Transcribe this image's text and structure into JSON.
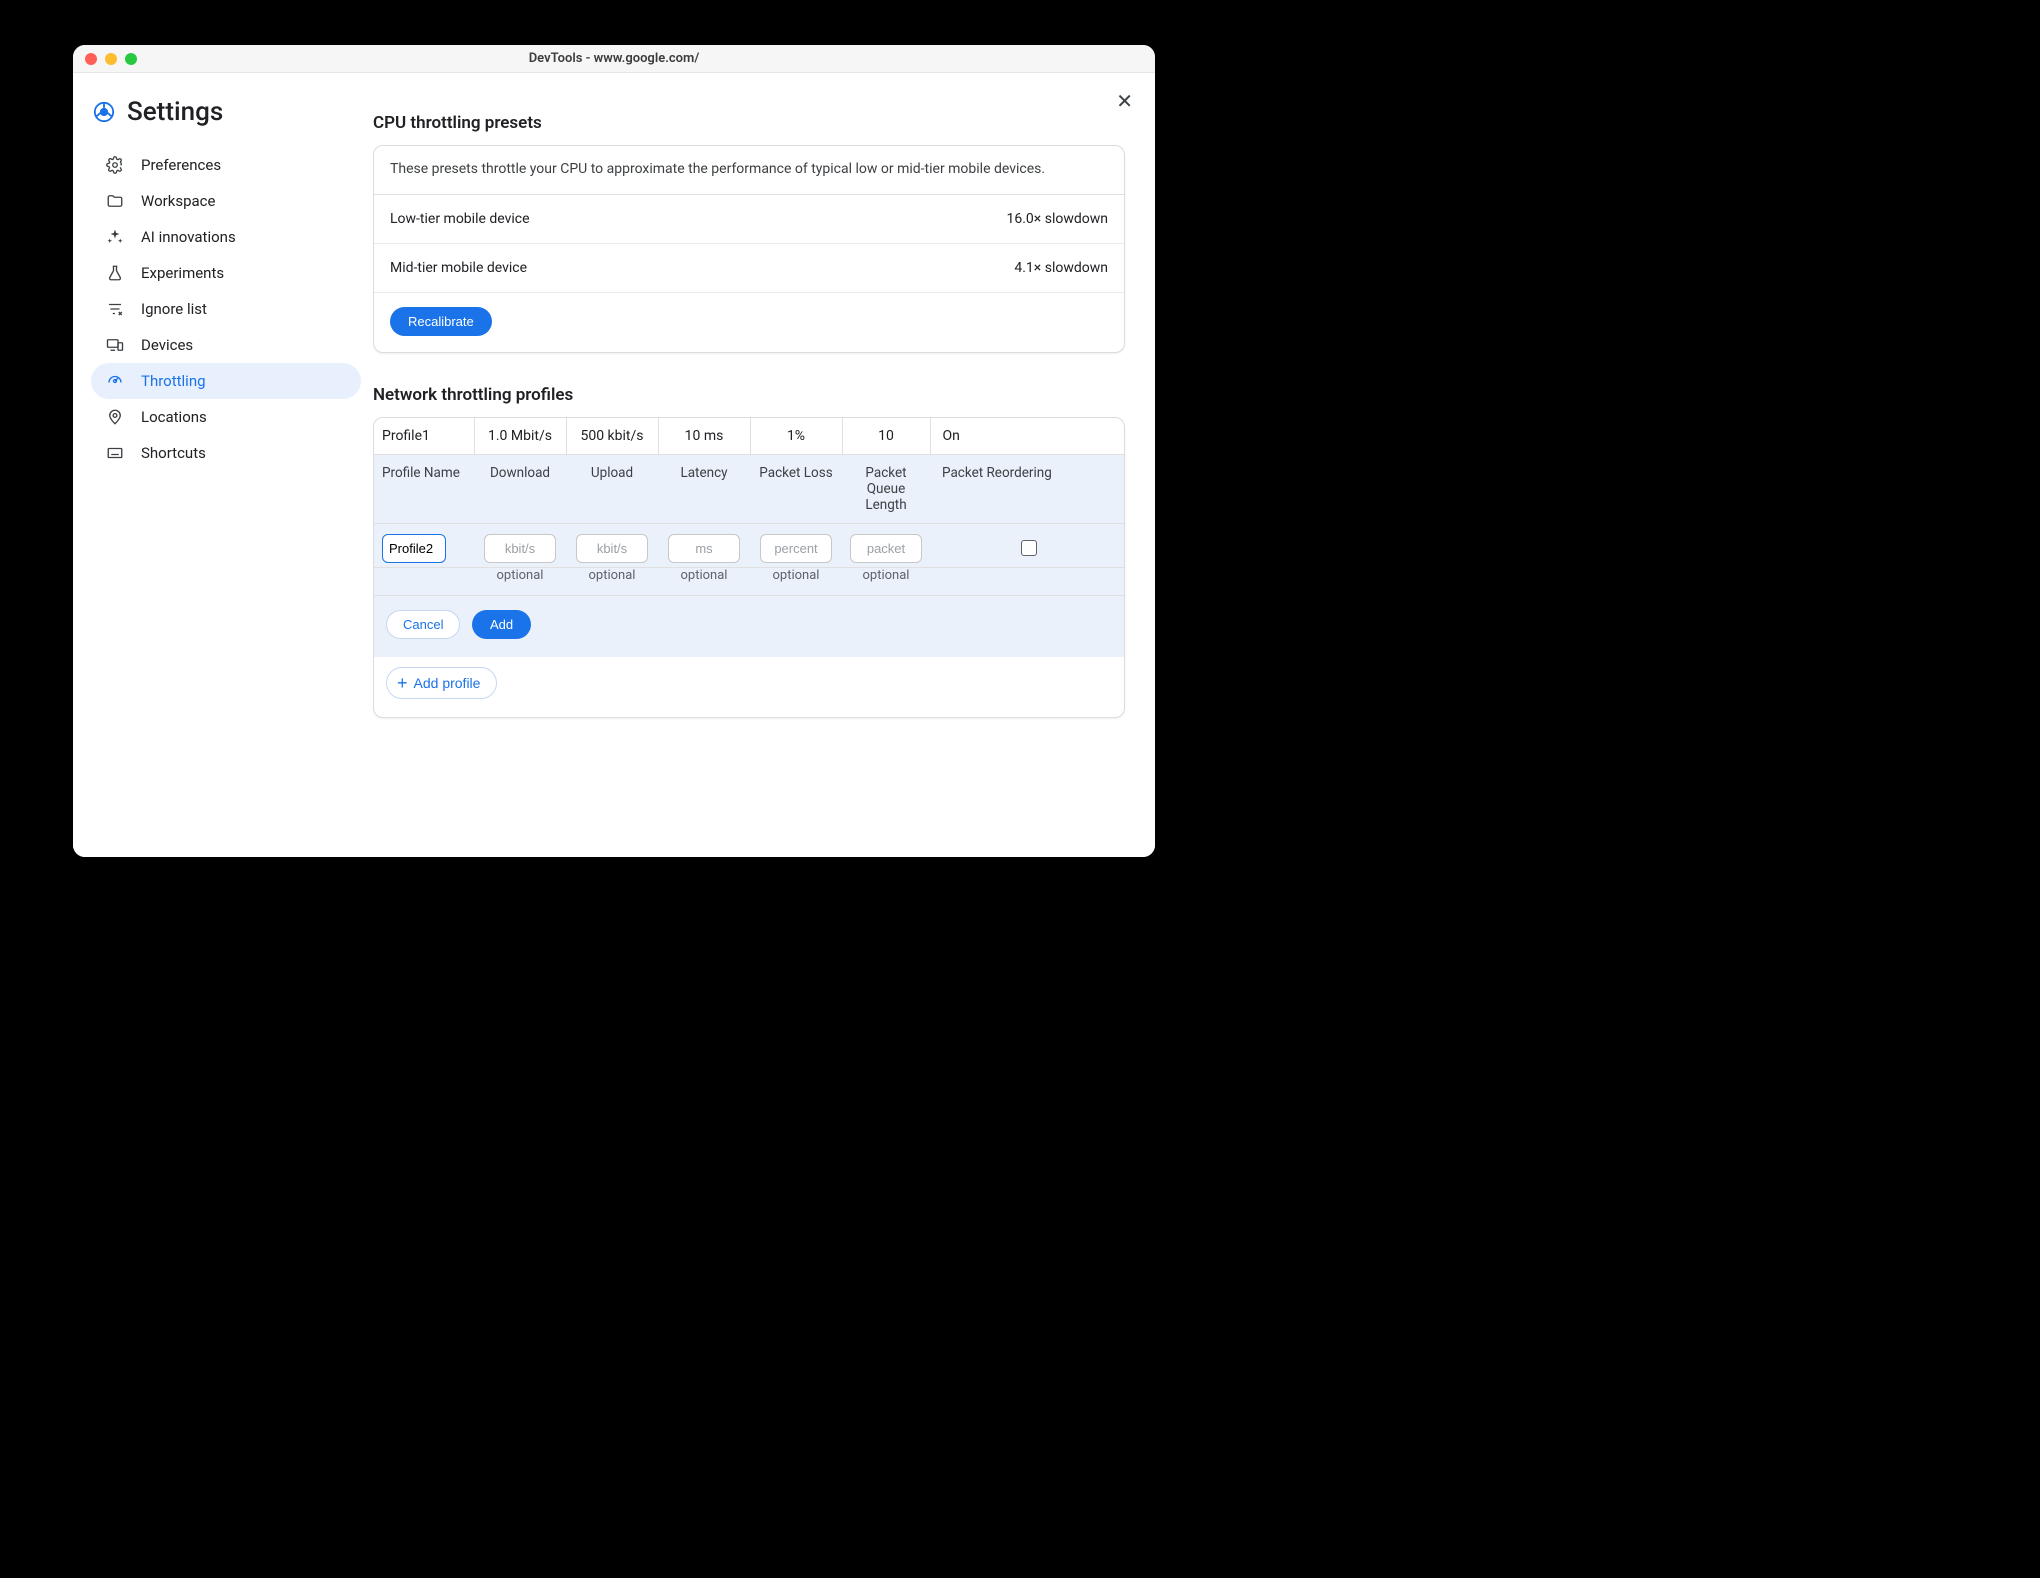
{
  "window_title": "DevTools - www.google.com/",
  "page_title": "Settings",
  "close_label": "✕",
  "sidebar": {
    "items": [
      {
        "label": "Preferences",
        "icon": "gear-icon"
      },
      {
        "label": "Workspace",
        "icon": "folder-icon"
      },
      {
        "label": "AI innovations",
        "icon": "sparkle-icon"
      },
      {
        "label": "Experiments",
        "icon": "flask-icon"
      },
      {
        "label": "Ignore list",
        "icon": "filter-icon"
      },
      {
        "label": "Devices",
        "icon": "devices-icon"
      },
      {
        "label": "Throttling",
        "icon": "speed-icon",
        "active": true
      },
      {
        "label": "Locations",
        "icon": "location-icon"
      },
      {
        "label": "Shortcuts",
        "icon": "keyboard-icon"
      }
    ]
  },
  "cpu_section": {
    "title": "CPU throttling presets",
    "description": "These presets throttle your CPU to approximate the performance of typical low or mid-tier mobile devices.",
    "presets": [
      {
        "name": "Low-tier mobile device",
        "value": "16.0× slowdown"
      },
      {
        "name": "Mid-tier mobile device",
        "value": "4.1× slowdown"
      }
    ],
    "recalibrate_label": "Recalibrate"
  },
  "network_section": {
    "title": "Network throttling profiles",
    "columns": {
      "name": "Profile Name",
      "download": "Download",
      "upload": "Upload",
      "latency": "Latency",
      "loss": "Packet Loss",
      "queue": "Packet Queue Length",
      "reorder": "Packet Reordering"
    },
    "profiles": [
      {
        "name": "Profile1",
        "download": "1.0 Mbit/s",
        "upload": "500 kbit/s",
        "latency": "10 ms",
        "loss": "1%",
        "queue": "10",
        "reorder": "On"
      }
    ],
    "new_profile": {
      "name_value": "Profile2",
      "download_placeholder": "kbit/s",
      "upload_placeholder": "kbit/s",
      "latency_placeholder": "ms",
      "loss_placeholder": "percent",
      "queue_placeholder": "packet",
      "optional_label": "optional",
      "reorder_checked": false
    },
    "cancel_label": "Cancel",
    "add_label": "Add",
    "add_profile_label": "Add profile"
  }
}
